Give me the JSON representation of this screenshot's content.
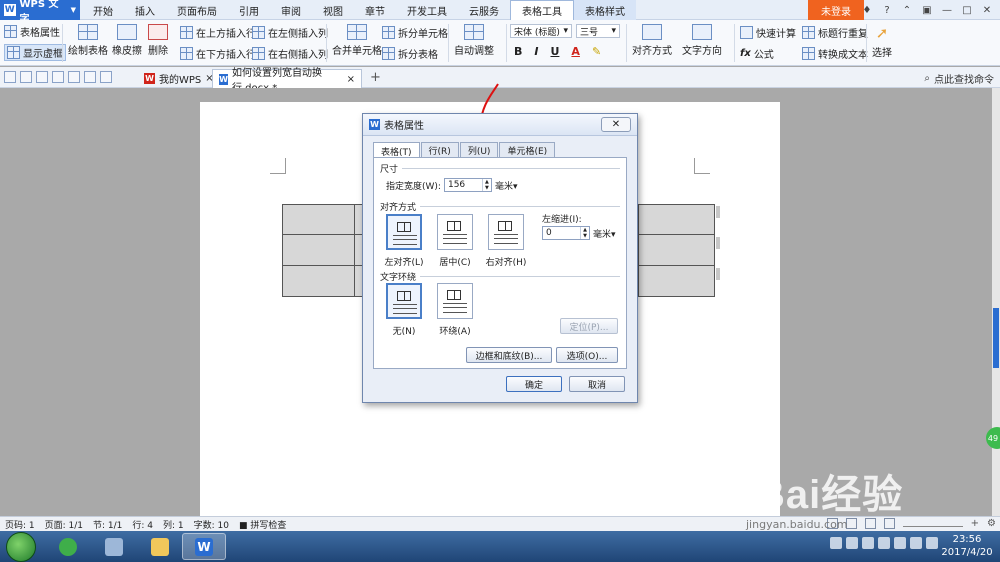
{
  "app": {
    "name": "WPS 文字",
    "logo_letter": "W"
  },
  "menu_tabs": [
    "开始",
    "插入",
    "页面布局",
    "引用",
    "审阅",
    "视图",
    "章节",
    "开发工具",
    "云服务"
  ],
  "context_tabs": [
    "表格工具",
    "表格样式"
  ],
  "login_label": "未登录",
  "title_controls": [
    "?"
  ],
  "ribbon": {
    "table_props": "表格属性",
    "show_gridlines": "显示虚框",
    "draw_table": "绘制表格",
    "eraser": "橡皮擦",
    "delete": "删除",
    "insert_above": "在上方插入行",
    "insert_below": "在下方插入行",
    "insert_left": "在左侧插入列",
    "insert_right": "在右侧插入列",
    "merge_cells": "合并单元格",
    "split_cells": "拆分单元格",
    "split_table": "拆分表格",
    "auto_fit": "自动调整",
    "font_name": "宋体 (标题)",
    "font_size": "三号",
    "bold": "B",
    "italic": "I",
    "underline": "U",
    "font_color": "A",
    "alignment": "对齐方式",
    "text_direction": "文字方向",
    "quick_calc": "快速计算",
    "repeat_header": "标题行重复",
    "fx_formula": "公式",
    "convert_text": "转换成文本",
    "select": "选择"
  },
  "doc_tabs": [
    {
      "label": "我的WPS"
    },
    {
      "label": "如何设置列宽自动换行.docx *"
    }
  ],
  "search_help": "点此查找命令",
  "dialog": {
    "title": "表格属性",
    "tabs": [
      "表格(T)",
      "行(R)",
      "列(U)",
      "单元格(E)"
    ],
    "size_section": "尺寸",
    "width_label": "指定宽度(W):",
    "width_value": "156",
    "width_unit": "毫米▾",
    "align_section": "对齐方式",
    "align_options": [
      "左对齐(L)",
      "居中(C)",
      "右对齐(H)"
    ],
    "indent_label": "左缩进(I):",
    "indent_value": "0",
    "indent_unit": "毫米▾",
    "wrap_section": "文字环绕",
    "wrap_options": [
      "无(N)",
      "环绕(A)"
    ],
    "position_btn": "定位(P)...",
    "borders_btn": "边框和底纹(B)...",
    "options_btn": "选项(O)...",
    "ok_btn": "确定",
    "cancel_btn": "取消"
  },
  "status": {
    "page_num": "页码: 1",
    "pages": "页面: 1/1",
    "section": "节: 1/1",
    "row": "行: 4",
    "col": "列: 1",
    "words": "字数: 10",
    "spell": "拼写检查"
  },
  "watermark": {
    "logo": "Bai经验",
    "url": "jingyan.baidu.com"
  },
  "side_bubble": "49",
  "clock": {
    "time": "23:56",
    "date": "2017/4/20"
  }
}
